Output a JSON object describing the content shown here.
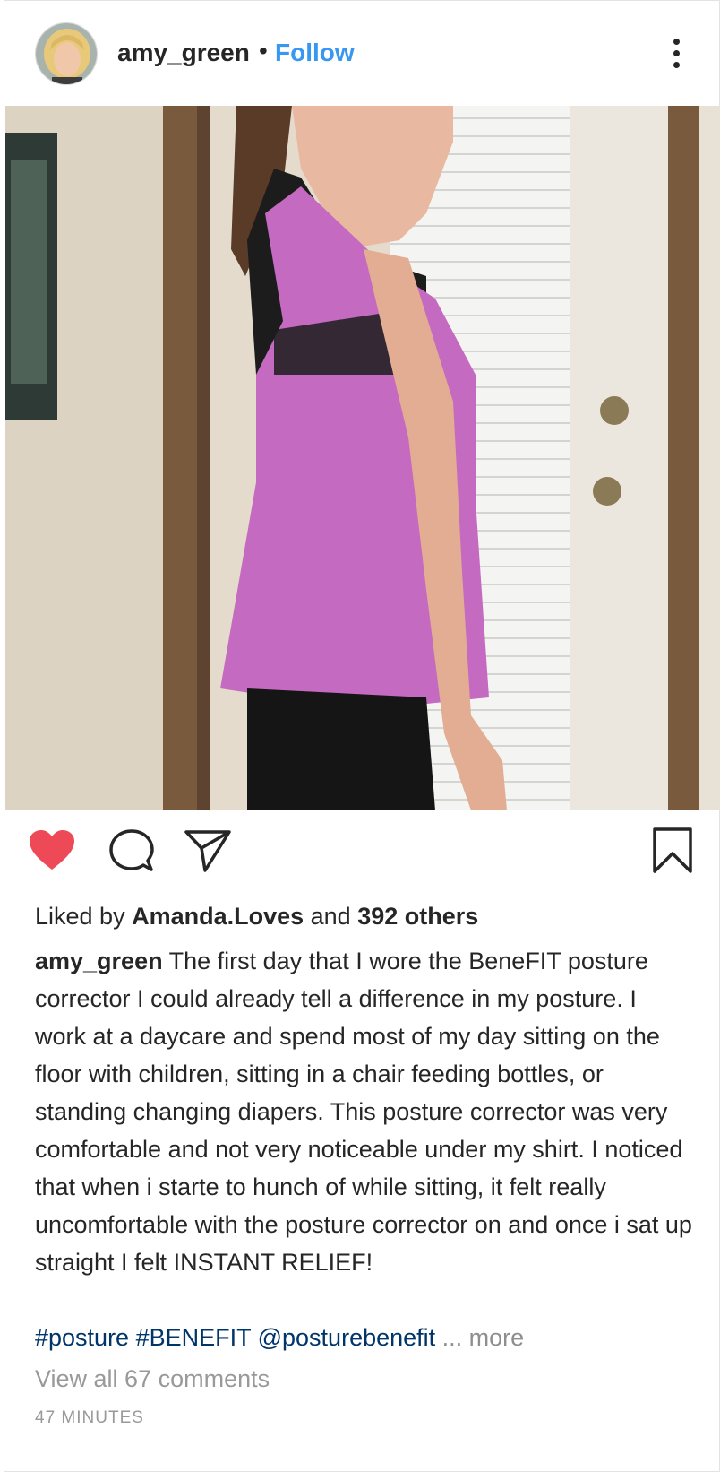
{
  "post": {
    "username": "amy_green",
    "separator": "•",
    "follow_label": "Follow",
    "menu_icon": "more-vertical-icon",
    "likes": {
      "prefix": "Liked by ",
      "liker": "Amanda.Loves",
      "middle": " and ",
      "others": "392 others"
    },
    "caption_user": "amy_green",
    "caption_text": " The first day that I wore the BeneFIT posture corrector I could already tell a difference in my posture. I work at a daycare and spend most of my day sitting on the floor with children, sitting in a chair feeding bottles, or standing changing diapers. This posture corrector was very comfortable and not very noticeable under my shirt. I noticed that when i starte to hunch of while sitting, it felt really uncomfortable with the posture corrector on and once i sat up straight I felt INSTANT RELIEF!",
    "tags": "#posture #BENEFIT @posturebenefit",
    "more_label": " ... more",
    "view_comments": "View all 67 comments",
    "timestamp": "47 MINUTES"
  },
  "icons": {
    "like": "heart-icon",
    "comment": "comment-icon",
    "share": "share-icon",
    "save": "bookmark-icon"
  },
  "colors": {
    "follow": "#3897f0",
    "liked_heart": "#ed4956",
    "hashtag": "#003569",
    "muted": "#999999"
  }
}
